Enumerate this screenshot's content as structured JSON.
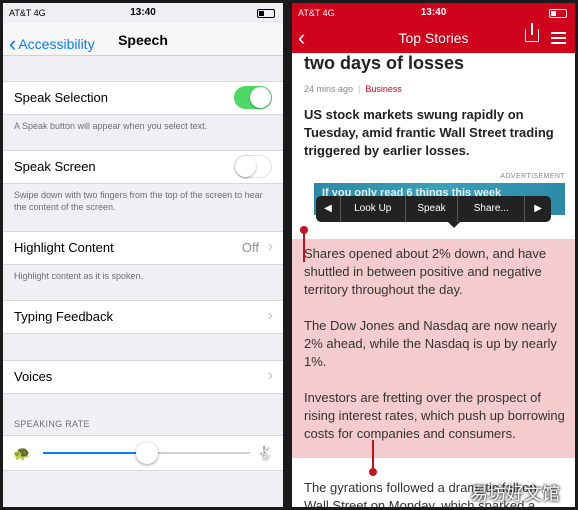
{
  "left": {
    "status": {
      "carrier": "AT&T 4G",
      "time": "13:40"
    },
    "nav": {
      "back_label": "Accessibility",
      "title": "Speech"
    },
    "rows": {
      "speak_selection": {
        "label": "Speak Selection",
        "on": true,
        "note": "A Speak button will appear when you select text."
      },
      "speak_screen": {
        "label": "Speak Screen",
        "on": false,
        "note": "Swipe down with two fingers from the top of the screen to hear the content of the screen."
      },
      "highlight_content": {
        "label": "Highlight Content",
        "value": "Off",
        "note": "Highlight content as it is spoken."
      },
      "typing_feedback": {
        "label": "Typing Feedback"
      },
      "voices": {
        "label": "Voices"
      }
    },
    "speaking_rate": {
      "header": "SPEAKING RATE",
      "value": 0.5
    },
    "colors": {
      "accent": "#0a7aff",
      "toggle_on": "#4cd964"
    }
  },
  "right": {
    "status": {
      "carrier": "AT&T 4G",
      "time": "13:40"
    },
    "nav": {
      "title": "Top Stories"
    },
    "article": {
      "headline": "two days of losses",
      "time_ago": "24 mins ago",
      "category": "Business",
      "lead": "US stock markets swung rapidly on Tuesday, amid frantic Wall Street trading triggered by earlier losses.",
      "advertisement_label": "ADVERTISEMENT",
      "ad_text": "If you only read 6 things this week",
      "paragraphs": [
        "Shares opened about 2% down, and have shuttled in between positive and negative territory throughout the day.",
        "The Dow Jones and Nasdaq are now nearly 2% ahead, while the Nasdaq is up by nearly 1%.",
        "Investors are fretting over the prospect of rising interest rates, which push up borrowing costs for companies and consumers.",
        "The gyrations followed a dramatic fall on Wall Street on Monday, which sparked a"
      ]
    },
    "popup": {
      "prev": "◀",
      "items": [
        "Look Up",
        "Speak",
        "Share..."
      ],
      "next": "▶"
    },
    "colors": {
      "brand": "#d0011b",
      "highlight": "#f4cccd"
    }
  },
  "watermark": "易坊好文馆"
}
